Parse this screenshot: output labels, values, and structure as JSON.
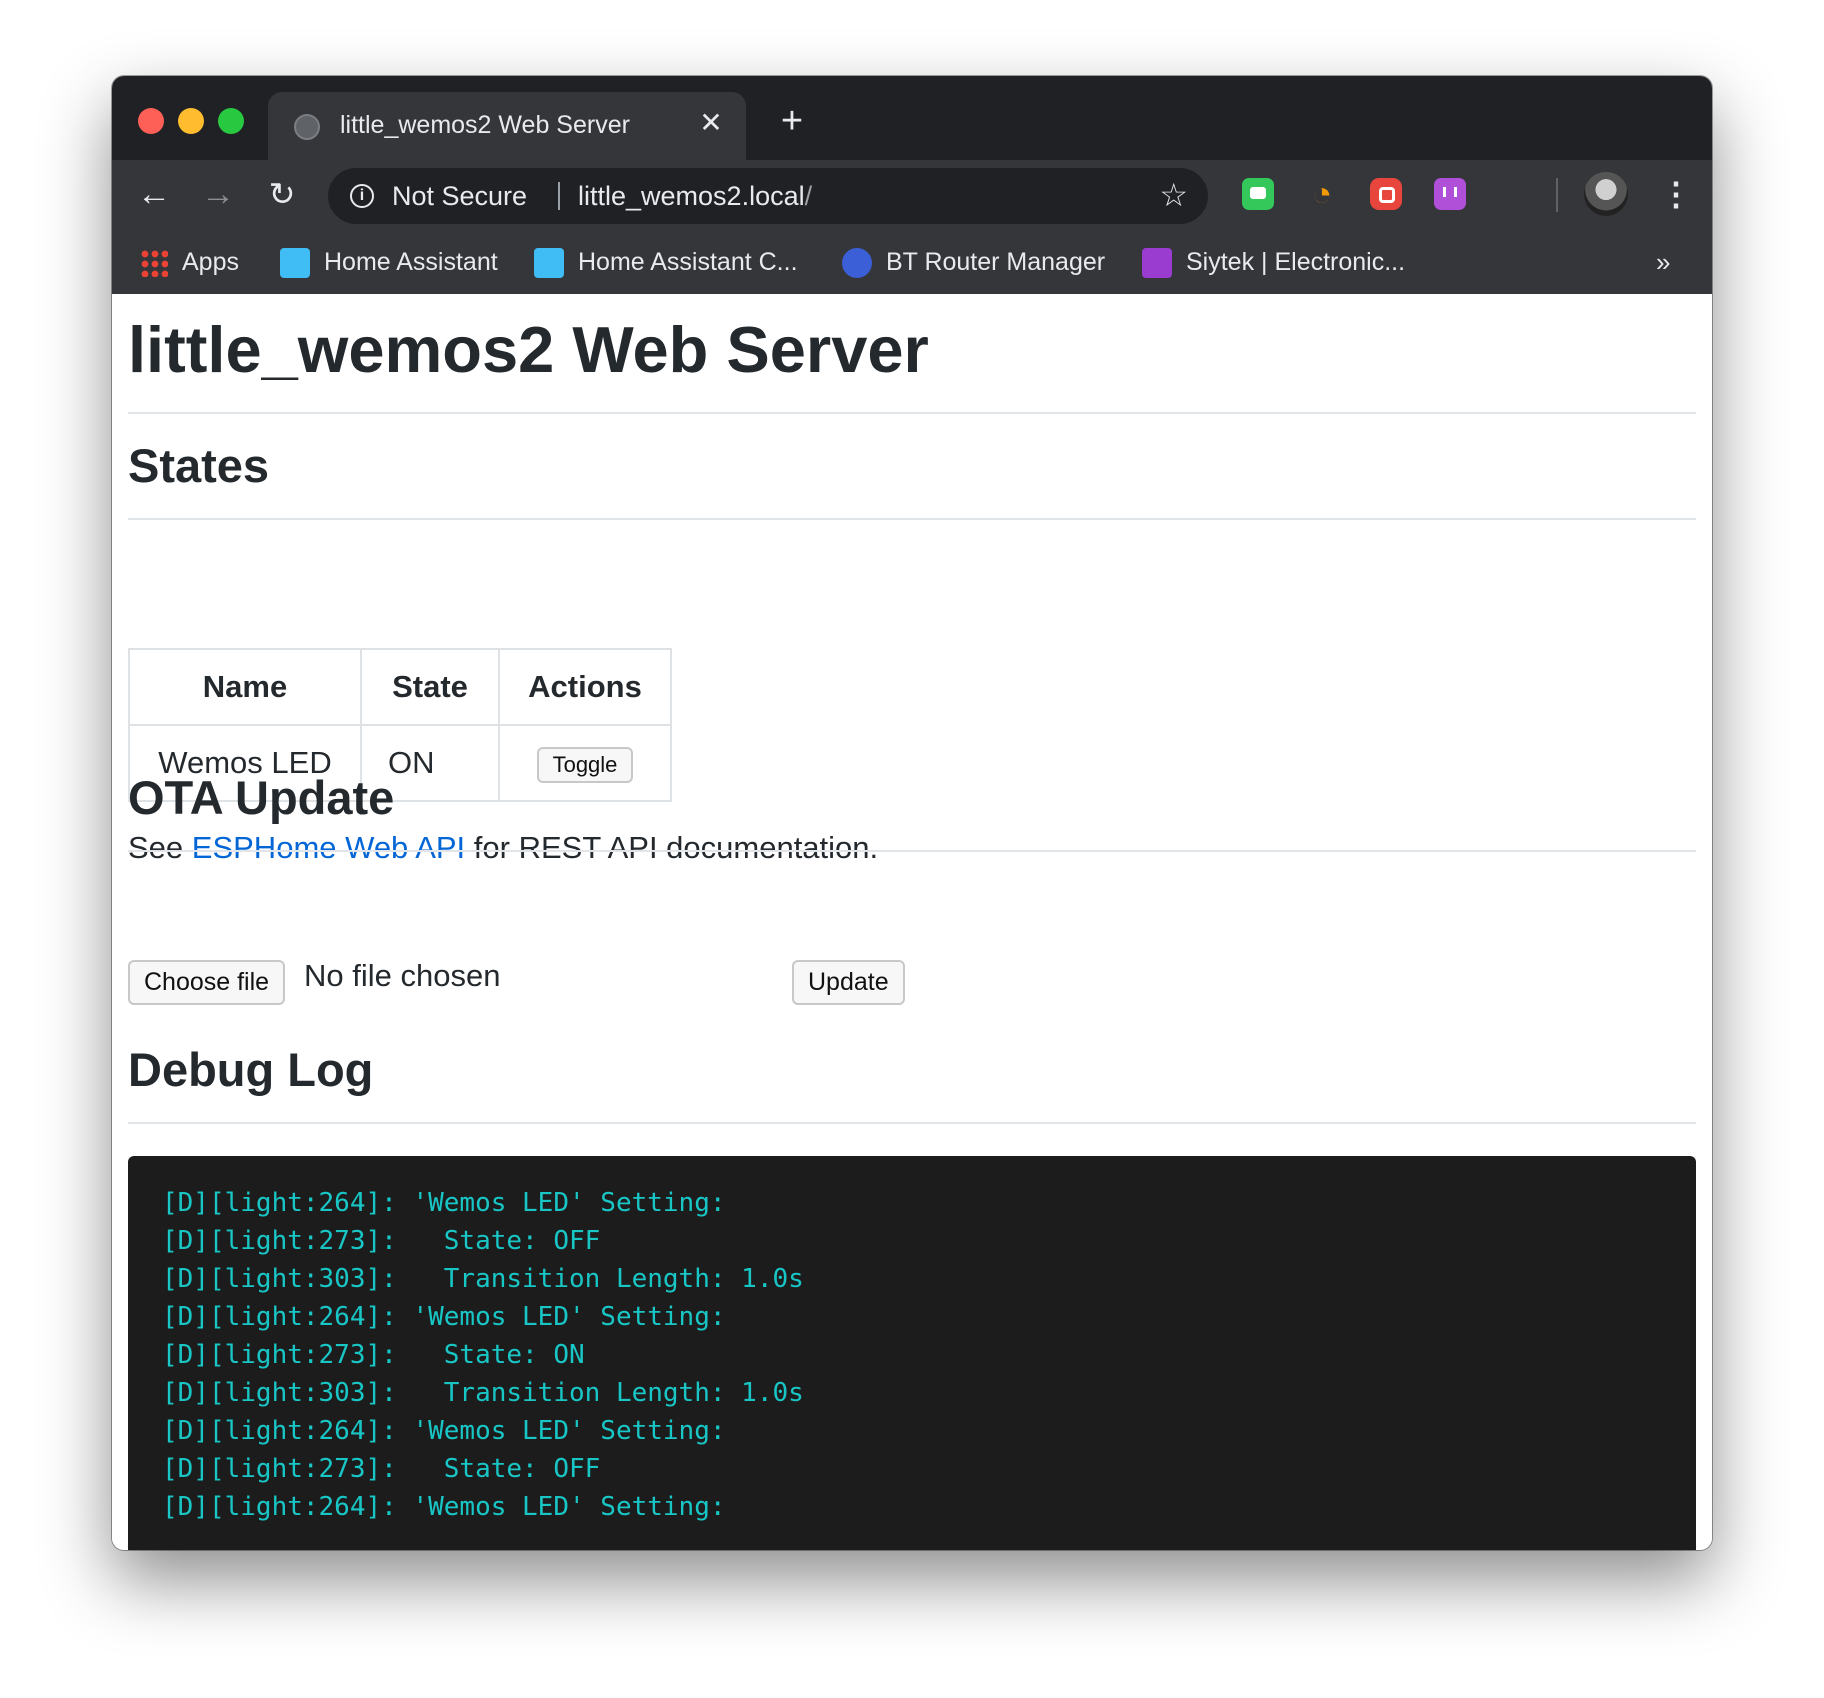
{
  "browser": {
    "tab": {
      "title": "little_wemos2 Web Server",
      "close_glyph": "✕",
      "favicon": "globe-icon"
    },
    "new_tab_glyph": "+",
    "nav": {
      "back_glyph": "←",
      "forward_glyph": "→",
      "reload_glyph": "↻"
    },
    "omnibox": {
      "security_label": "Not Secure",
      "url_host": "little_wemos2.local",
      "url_path": "/",
      "star_glyph": "☆"
    },
    "extensions": [
      "chat-extension-icon",
      "rss-extension-icon",
      "camera-extension-icon",
      "stats-extension-icon"
    ],
    "menu_glyph": "⋮",
    "bookmarks": [
      {
        "label": "Apps",
        "icon": "apps-grid-icon"
      },
      {
        "label": "Home Assistant",
        "icon": "home-assistant-icon"
      },
      {
        "label": "Home Assistant C...",
        "icon": "home-assistant-icon"
      },
      {
        "label": "BT Router Manager",
        "icon": "bt-icon"
      },
      {
        "label": "Siytek | Electronic...",
        "icon": "siytek-icon"
      }
    ],
    "bookmarks_more_glyph": "»"
  },
  "page": {
    "title": "little_wemos2 Web Server",
    "states": {
      "heading": "States",
      "columns": [
        "Name",
        "State",
        "Actions"
      ],
      "rows": [
        {
          "name": "Wemos LED",
          "state": "ON",
          "action_label": "Toggle"
        }
      ]
    },
    "api_note": {
      "prefix": "See ",
      "link_text": "ESPHome Web API",
      "suffix": " for REST API documentation."
    },
    "ota": {
      "heading": "OTA Update",
      "choose_label": "Choose file",
      "file_status": "No file chosen",
      "update_label": "Update"
    },
    "debug": {
      "heading": "Debug Log",
      "lines": [
        "[D][light:264]: 'Wemos LED' Setting:",
        "[D][light:273]:   State: OFF",
        "[D][light:303]:   Transition Length: 1.0s",
        "[D][light:264]: 'Wemos LED' Setting:",
        "[D][light:273]:   State: ON",
        "[D][light:303]:   Transition Length: 1.0s",
        "[D][light:264]: 'Wemos LED' Setting:",
        "[D][light:273]:   State: OFF",
        "[D][light:264]: 'Wemos LED' Setting:"
      ]
    }
  },
  "colors": {
    "link": "#0366d6",
    "log_text": "#19c6c6",
    "log_bg": "#1c1c1c",
    "chrome_dark": "#202124"
  }
}
